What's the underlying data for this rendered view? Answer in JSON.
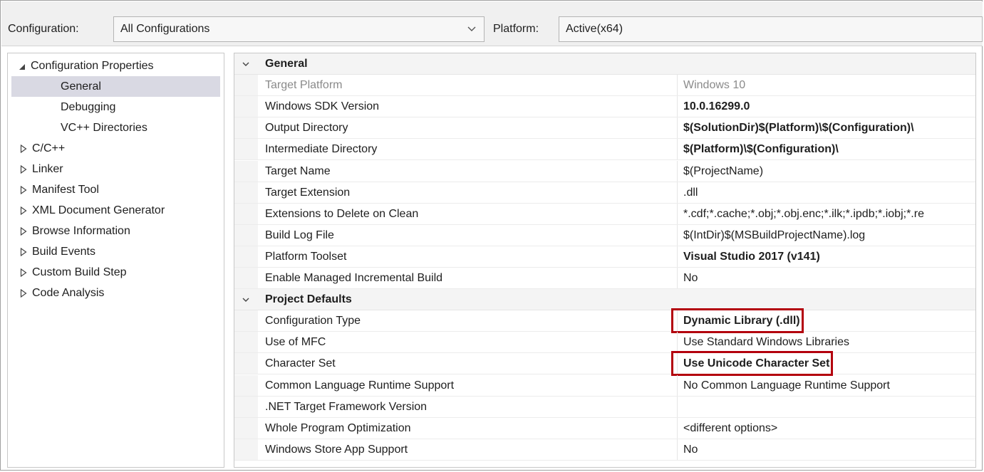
{
  "toolbar": {
    "configuration_label": "Configuration:",
    "configuration_value": "All Configurations",
    "platform_label": "Platform:",
    "platform_value": "Active(x64)"
  },
  "tree": {
    "root": "Configuration Properties",
    "items": [
      {
        "label": "General",
        "expandable": false,
        "selected": true
      },
      {
        "label": "Debugging",
        "expandable": false
      },
      {
        "label": "VC++ Directories",
        "expandable": false
      },
      {
        "label": "C/C++",
        "expandable": true
      },
      {
        "label": "Linker",
        "expandable": true
      },
      {
        "label": "Manifest Tool",
        "expandable": true
      },
      {
        "label": "XML Document Generator",
        "expandable": true
      },
      {
        "label": "Browse Information",
        "expandable": true
      },
      {
        "label": "Build Events",
        "expandable": true
      },
      {
        "label": "Custom Build Step",
        "expandable": true
      },
      {
        "label": "Code Analysis",
        "expandable": true
      }
    ]
  },
  "grid": {
    "categories": [
      {
        "name": "General",
        "rows": [
          {
            "name": "Target Platform",
            "value": "Windows 10",
            "dim": true
          },
          {
            "name": "Windows SDK Version",
            "value": "10.0.16299.0",
            "bold": true
          },
          {
            "name": "Output Directory",
            "value": "$(SolutionDir)$(Platform)\\$(Configuration)\\",
            "bold": true
          },
          {
            "name": "Intermediate Directory",
            "value": "$(Platform)\\$(Configuration)\\",
            "bold": true
          },
          {
            "name": "Target Name",
            "value": "$(ProjectName)"
          },
          {
            "name": "Target Extension",
            "value": ".dll"
          },
          {
            "name": "Extensions to Delete on Clean",
            "value": "*.cdf;*.cache;*.obj;*.obj.enc;*.ilk;*.ipdb;*.iobj;*.re"
          },
          {
            "name": "Build Log File",
            "value": "$(IntDir)$(MSBuildProjectName).log"
          },
          {
            "name": "Platform Toolset",
            "value": "Visual Studio 2017 (v141)",
            "bold": true
          },
          {
            "name": "Enable Managed Incremental Build",
            "value": "No"
          }
        ]
      },
      {
        "name": "Project Defaults",
        "rows": [
          {
            "name": "Configuration Type",
            "value": "Dynamic Library (.dll)",
            "bold": true,
            "highlighted": true
          },
          {
            "name": "Use of MFC",
            "value": "Use Standard Windows Libraries"
          },
          {
            "name": "Character Set",
            "value": "Use Unicode Character Set",
            "bold": true,
            "highlighted": true
          },
          {
            "name": "Common Language Runtime Support",
            "value": "No Common Language Runtime Support"
          },
          {
            "name": ".NET Target Framework Version",
            "value": ""
          },
          {
            "name": "Whole Program Optimization",
            "value": "<different options>"
          },
          {
            "name": "Windows Store App Support",
            "value": "No"
          }
        ]
      }
    ]
  },
  "colors": {
    "highlight_box": "#b3000d",
    "selected_tree_item": "#d9d9e3",
    "dim_text": "#8a8a8a"
  }
}
